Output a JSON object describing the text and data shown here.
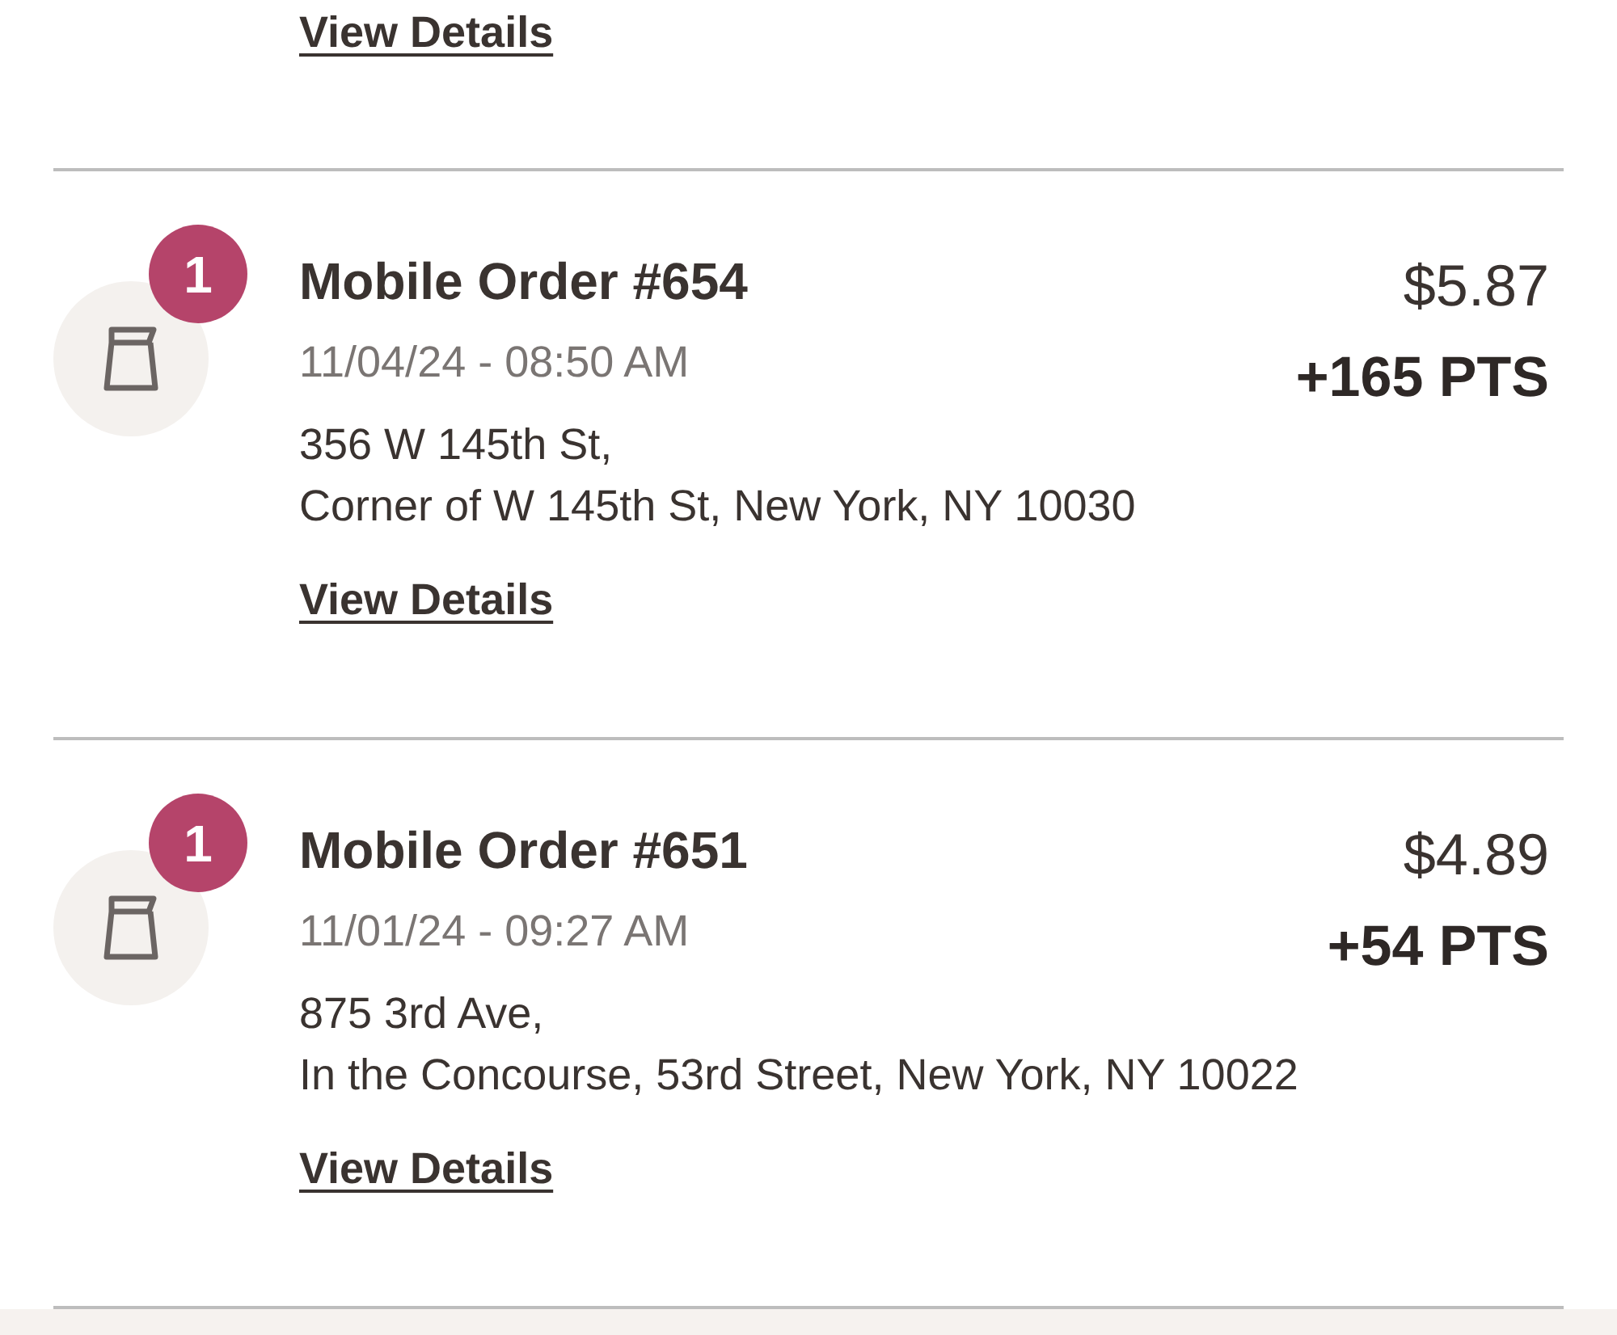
{
  "previous_order": {
    "link": "View Details"
  },
  "orders": [
    {
      "badge": "1",
      "title": "Mobile Order #654",
      "datetime": "11/04/24 - 08:50 AM",
      "address_lines": [
        "356 W 145th St,",
        "Corner of W 145th St, New York, NY 10030"
      ],
      "link": "View Details",
      "price": "$5.87",
      "points": "+165 PTS"
    },
    {
      "badge": "1",
      "title": "Mobile Order #651",
      "datetime": "11/01/24 - 09:27 AM",
      "address_lines": [
        "875 3rd Ave,",
        "In the Concourse, 53rd Street, New York, NY 10022"
      ],
      "link": "View Details",
      "price": "$4.89",
      "points": "+54 PTS"
    }
  ]
}
